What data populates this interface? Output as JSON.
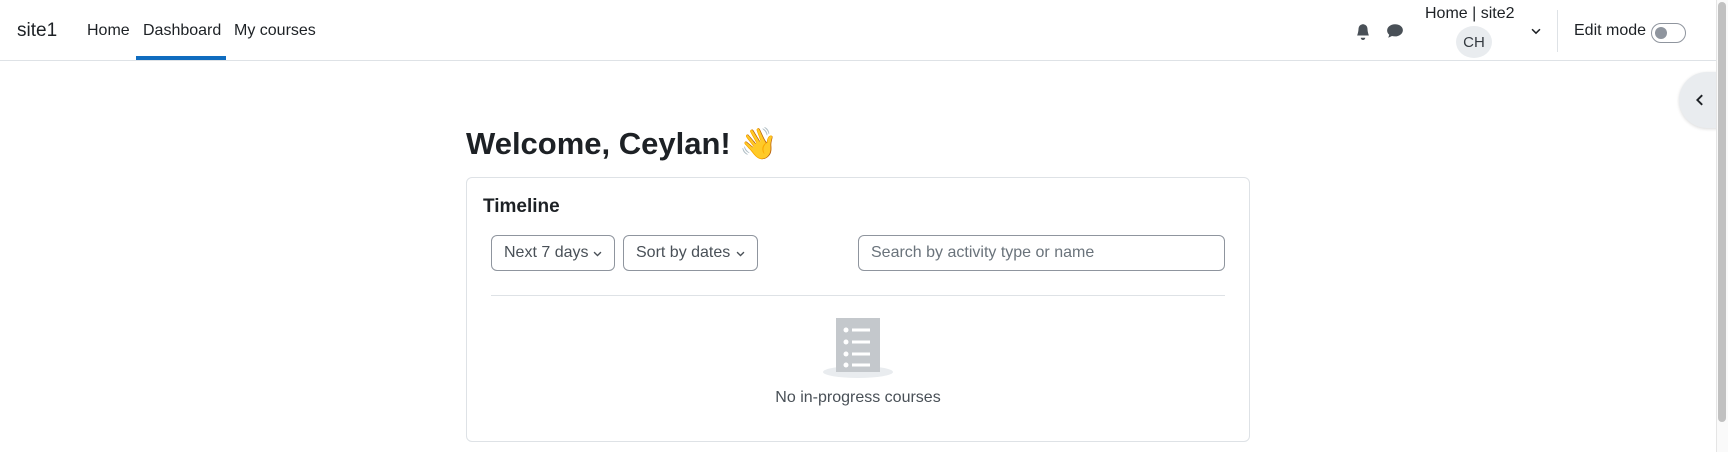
{
  "navbar": {
    "brand": "site1",
    "links": [
      {
        "label": "Home"
      },
      {
        "label": "Dashboard",
        "active": true
      },
      {
        "label": "My courses"
      }
    ],
    "site_title": "Home | site2",
    "user_initials": "CH",
    "edit_mode_label": "Edit mode",
    "edit_mode_on": false,
    "icons": [
      "bell-icon",
      "chat-icon",
      "chevron-down-icon"
    ]
  },
  "drawer": {
    "icon": "chevron-left-icon"
  },
  "page": {
    "title": "Welcome, Ceylan! 👋"
  },
  "timeline": {
    "title": "Timeline",
    "filter_label": "Next 7 days",
    "sort_label": "Sort by dates",
    "search_placeholder": "Search by activity type or name",
    "empty_message": "No in-progress courses"
  },
  "colors": {
    "accent": "#0f6cbf",
    "border": "#dee2e6",
    "text": "#1d2125",
    "muted": "#495057",
    "icon_gray": "#c4c8cc"
  }
}
